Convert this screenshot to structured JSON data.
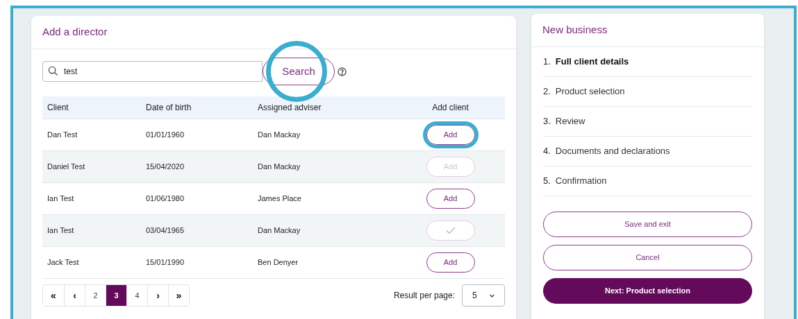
{
  "director_panel": {
    "title": "Add a director",
    "search": {
      "value": "test",
      "button": "Search",
      "highlighted": true
    },
    "table": {
      "columns": [
        "Client",
        "Date of birth",
        "Assigned adviser",
        "Add client"
      ],
      "rows": [
        {
          "client": "Dan Test",
          "date_of_birth": "01/01/1960",
          "adviser": "Dan Mackay",
          "action": {
            "kind": "add",
            "label": "Add",
            "disabled": false,
            "highlighted": true
          }
        },
        {
          "client": "Daniel Test",
          "date_of_birth": "15/04/2020",
          "adviser": "Dan Mackay",
          "action": {
            "kind": "add",
            "label": "Add",
            "disabled": true,
            "highlighted": false
          }
        },
        {
          "client": "Ian Test",
          "date_of_birth": "01/06/1980",
          "adviser": "James Place",
          "action": {
            "kind": "add",
            "label": "Add",
            "disabled": false,
            "highlighted": false
          }
        },
        {
          "client": "Ian Test",
          "date_of_birth": "03/04/1965",
          "adviser": "Dan Mackay",
          "action": {
            "kind": "added",
            "disabled": true,
            "highlighted": false
          }
        },
        {
          "client": "Jack Test",
          "date_of_birth": "15/01/1990",
          "adviser": "Ben Denyer",
          "action": {
            "kind": "add",
            "label": "Add",
            "disabled": false,
            "highlighted": false
          }
        }
      ]
    },
    "pagination": [
      {
        "label": "«",
        "selected": false
      },
      {
        "label": "‹",
        "selected": false
      },
      {
        "label": "2",
        "selected": false
      },
      {
        "label": "3",
        "selected": true
      },
      {
        "label": "4",
        "selected": false
      },
      {
        "label": "›",
        "selected": false
      },
      {
        "label": "»",
        "selected": false
      }
    ],
    "per_page": {
      "label": "Result per page:",
      "value": "5"
    }
  },
  "new_business": {
    "title": "New business",
    "steps": [
      {
        "number": "1.",
        "label": "Full client details",
        "selected": true
      },
      {
        "number": "2.",
        "label": "Product selection",
        "selected": false
      },
      {
        "number": "3.",
        "label": "Review",
        "selected": false
      },
      {
        "number": "4.",
        "label": "Documents and declarations",
        "selected": false
      },
      {
        "number": "5.",
        "label": "Confirmation",
        "selected": false
      }
    ],
    "buttons": [
      {
        "label": "Save and exit",
        "kind": "outline"
      },
      {
        "label": "Cancel",
        "kind": "outline"
      },
      {
        "label": "Next: Product selection",
        "kind": "primary"
      }
    ]
  }
}
